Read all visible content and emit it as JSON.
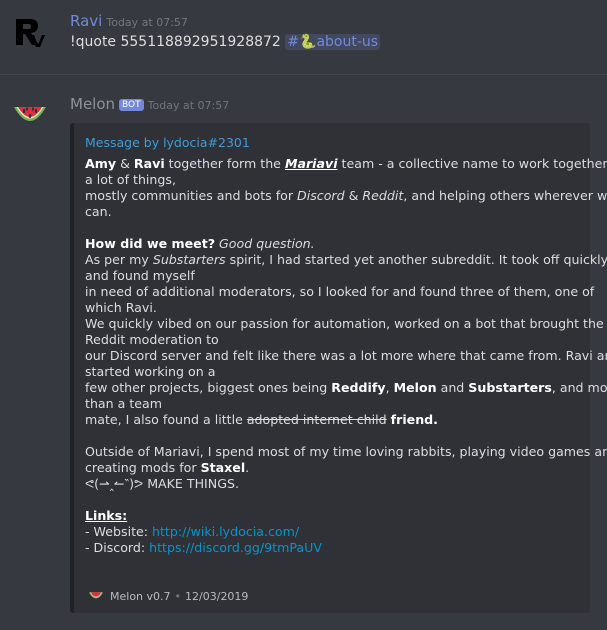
{
  "messages": [
    {
      "author": "Ravi",
      "author_color": "#7289da",
      "timestamp": "Today at 07:57",
      "text": "!quote 555118892951928872",
      "channel_mention": "about-us",
      "avatar": "ravi-logo-icon"
    },
    {
      "author": "Melon",
      "author_color": "#8e9297",
      "badge": "BOT",
      "timestamp": "Today at 07:57",
      "avatar": "watermelon-icon",
      "embed": {
        "author": "Message by lydocia#2301",
        "lines": {
          "l1_a": "Amy",
          "l1_b": " & ",
          "l1_c": "Ravi",
          "l1_d": " together form the ",
          "l1_e": "Mariavi",
          "l1_f": " team - a collective name to work together on",
          "l2": "a lot of things,",
          "l3_a": "mostly communities and bots for ",
          "l3_b": "Discord",
          "l3_c": " & ",
          "l3_d": "Reddit",
          "l3_e": ", and helping others wherever we",
          "l4": "can.",
          "l5_a": "How did we meet?",
          "l5_b": " Good question.",
          "l6_a": "As per my ",
          "l6_b": "Substarters",
          "l6_c": " spirit, I had started yet another subreddit. It took off quickly",
          "l7": "and found myself",
          "l8": "in need of additional moderators, so I looked for and found three of them, one of",
          "l9": "which Ravi.",
          "l10": "We quickly vibed on our passion for automation, worked on a bot that brought the",
          "l11": "Reddit moderation to",
          "l12": "our Discord server and felt like there was a lot more where that came from. Ravi and I",
          "l13": "started working on a",
          "l14_a": "few other projects, biggest ones being ",
          "l14_b": "Reddify",
          "l14_c": ", ",
          "l14_d": "Melon",
          "l14_e": " and ",
          "l14_f": "Substarters",
          "l14_g": ", and more",
          "l15": "than a team",
          "l16_a": "mate, I also found a little ",
          "l16_b": "adopted internet child",
          "l16_c": " ",
          "l16_d": "friend.",
          "l17": "Outside of Mariavi, I spend most of my time loving rabbits, playing video games and",
          "l18_a": "creating mods for ",
          "l18_b": "Staxel",
          "l18_c": ".",
          "l19": "ᕙ(⇀‸↼‶)ᕗ MAKE THINGS.",
          "l20": "Links:",
          "l21_a": "- Website: ",
          "l21_b": "http://wiki.lydocia.com/",
          "l22_a": "- Discord: ",
          "l22_b": "https://discord.gg/9tmPaUV"
        },
        "footer": {
          "bot": "Melon v0.7",
          "separator": "•",
          "date": "12/03/2019"
        }
      }
    }
  ]
}
